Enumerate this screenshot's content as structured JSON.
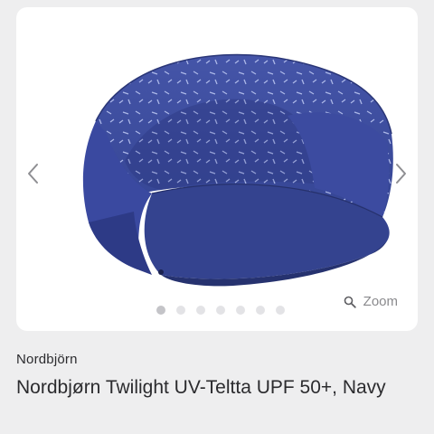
{
  "product": {
    "brand": "Nordbjörn",
    "title": "Nordbjørn Twilight UV-Teltta UPF 50+, Navy",
    "image_alt": "Nordbjørn Twilight UV-Teltta UPF 50+, Navy"
  },
  "gallery": {
    "zoom_label": "Zoom",
    "total_images": 7,
    "active_index": 0
  },
  "colors": {
    "tent_main": "#3e4d9e",
    "tent_floor": "#34438f",
    "tent_shadow": "#24306d",
    "card_background": "#ffffff",
    "page_background": "#eeeeef"
  },
  "icons": {
    "prev": "chevron-left-icon",
    "next": "chevron-right-icon",
    "zoom": "magnifier-icon"
  }
}
